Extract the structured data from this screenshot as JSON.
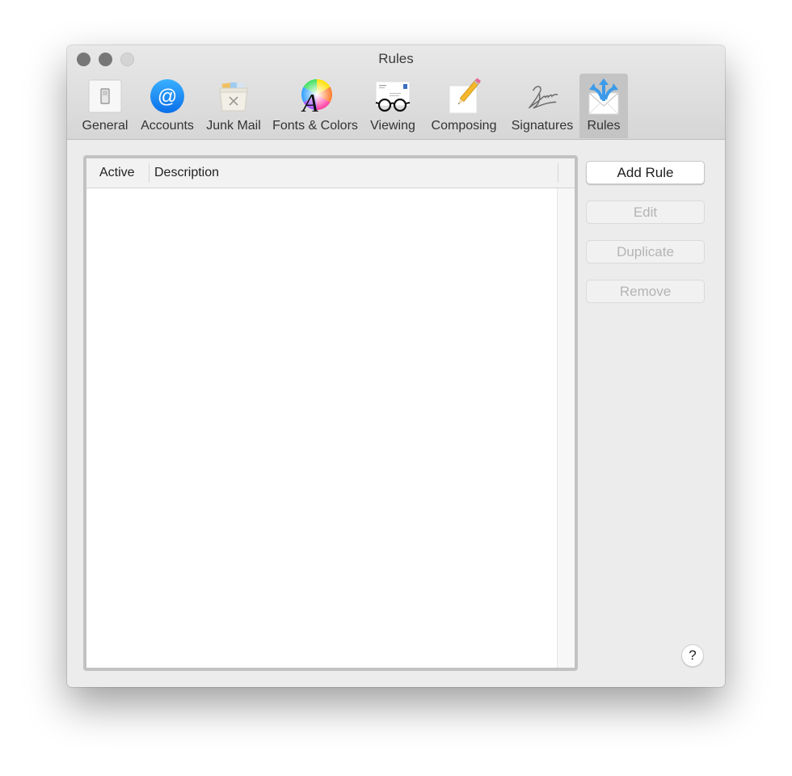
{
  "window": {
    "title": "Rules",
    "traffic_lights": [
      "close",
      "minimize",
      "zoom"
    ]
  },
  "toolbar": {
    "selected": "rules",
    "items": [
      {
        "id": "general",
        "label": "General",
        "icon": "light-switch-icon"
      },
      {
        "id": "accounts",
        "label": "Accounts",
        "icon": "at-sign-icon"
      },
      {
        "id": "junk-mail",
        "label": "Junk Mail",
        "icon": "junk-basket-icon"
      },
      {
        "id": "fonts-colors",
        "label": "Fonts & Colors",
        "icon": "font-color-wheel-icon"
      },
      {
        "id": "viewing",
        "label": "Viewing",
        "icon": "glasses-envelope-icon"
      },
      {
        "id": "composing",
        "label": "Composing",
        "icon": "pencil-paper-icon"
      },
      {
        "id": "signatures",
        "label": "Signatures",
        "icon": "signature-icon"
      },
      {
        "id": "rules",
        "label": "Rules",
        "icon": "envelope-arrows-icon"
      }
    ],
    "icon_glyphs": {
      "at": "@",
      "cross": "×",
      "font_letter": "A"
    }
  },
  "rules_table": {
    "columns": [
      "Active",
      "Description"
    ],
    "rows": []
  },
  "actions": {
    "add_rule": {
      "label": "Add Rule",
      "enabled": true
    },
    "edit": {
      "label": "Edit",
      "enabled": false
    },
    "duplicate": {
      "label": "Duplicate",
      "enabled": false
    },
    "remove": {
      "label": "Remove",
      "enabled": false
    }
  },
  "help": {
    "label": "?"
  },
  "colors": {
    "accounts_blue": "#1a8cff",
    "rules_arrow_blue": "#3d9be9",
    "selected_tab_bg": "#c4c4c4",
    "disabled_text": "#b4b4b4"
  }
}
